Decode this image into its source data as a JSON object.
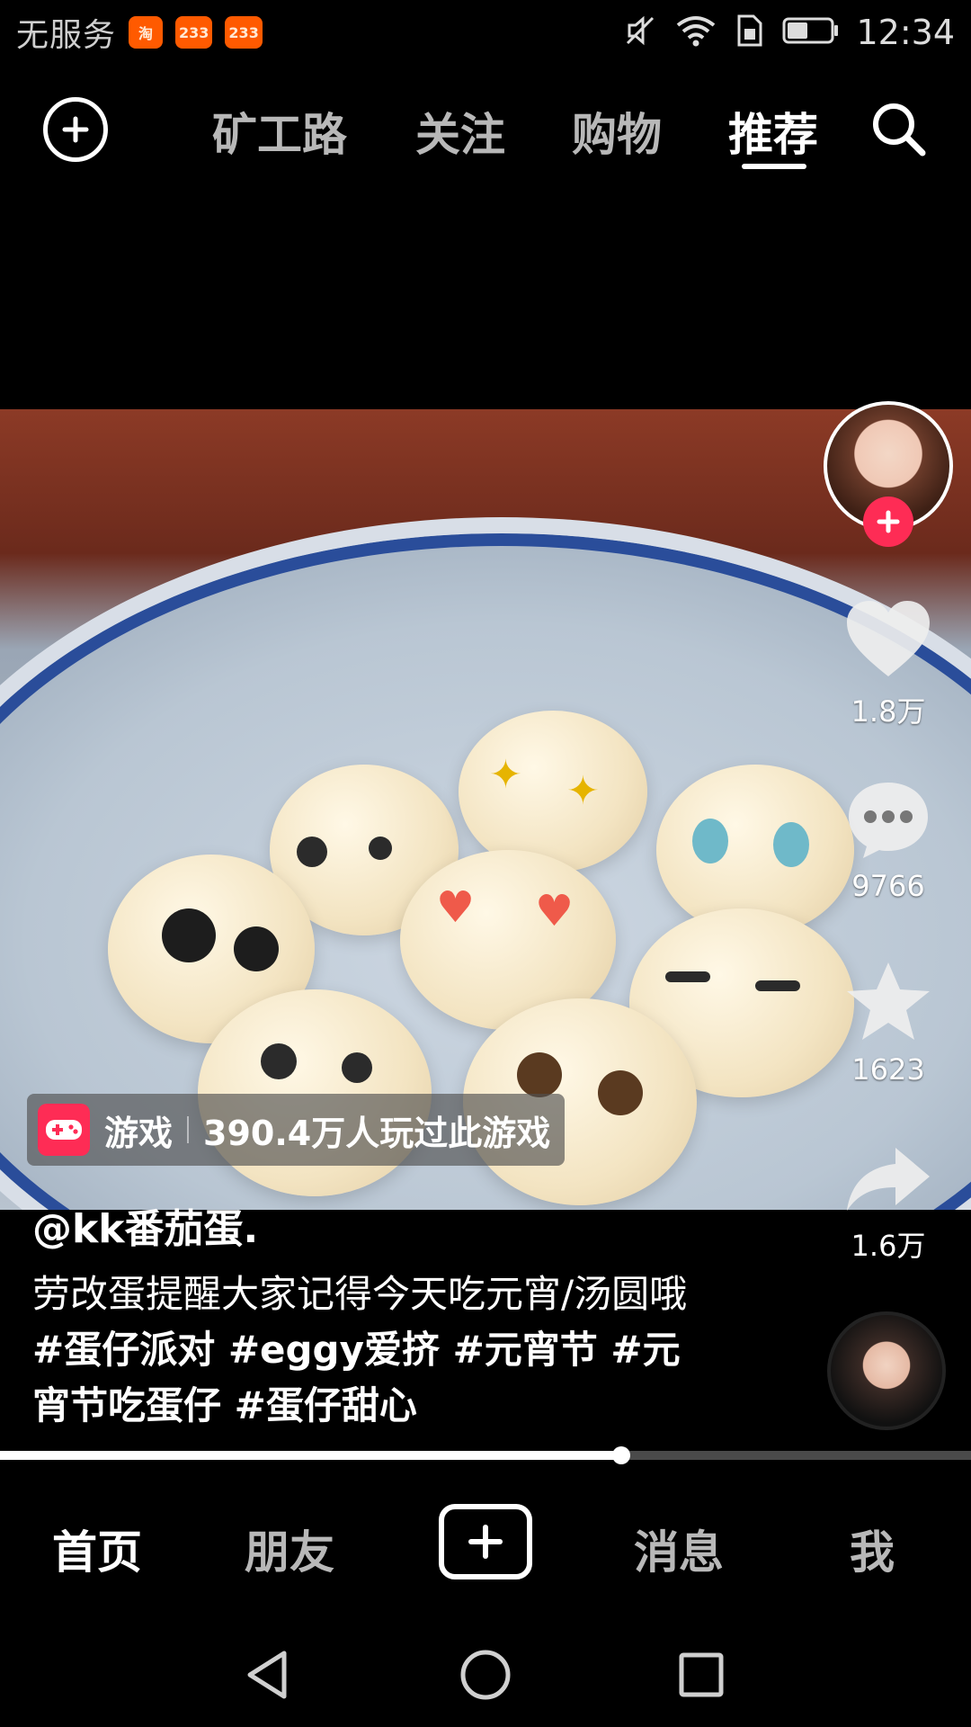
{
  "status_bar": {
    "carrier": "无服务",
    "app_badges": [
      "淘",
      "233",
      "233"
    ],
    "time": "12:34",
    "icons": [
      "mute-icon",
      "wifi-icon",
      "sim-icon",
      "battery-icon"
    ]
  },
  "top_nav": {
    "live_icon": "plus-circle-icon",
    "tabs": [
      {
        "label": "矿工路"
      },
      {
        "label": "关注"
      },
      {
        "label": "购物"
      },
      {
        "label": "推荐"
      }
    ],
    "active_tab": "推荐",
    "search_icon": "search-icon"
  },
  "video": {
    "scene": "汤圆"
  },
  "right_rail": {
    "like_count": "1.8万",
    "comment_count": "9766",
    "favorite_count": "1623",
    "share_count": "1.6万"
  },
  "game_pill": {
    "label": "游戏",
    "detail": "390.4万人玩过此游戏"
  },
  "caption": {
    "author": "@kk番茄蛋.",
    "text": "劳改蛋提醒大家记得今天吃元宵/汤圆哦",
    "tags": "#蛋仔派对 #eggy爱挤 #元宵节 #元宵节吃蛋仔 #蛋仔甜心"
  },
  "progress": {
    "value": 0.64
  },
  "bottom_nav": {
    "home": "首页",
    "friends": "朋友",
    "messages": "消息",
    "me": "我",
    "active": "首页"
  },
  "colors": {
    "accent": "#fe2c55",
    "background": "#000000",
    "inactive_text": "#b8b8b8"
  }
}
